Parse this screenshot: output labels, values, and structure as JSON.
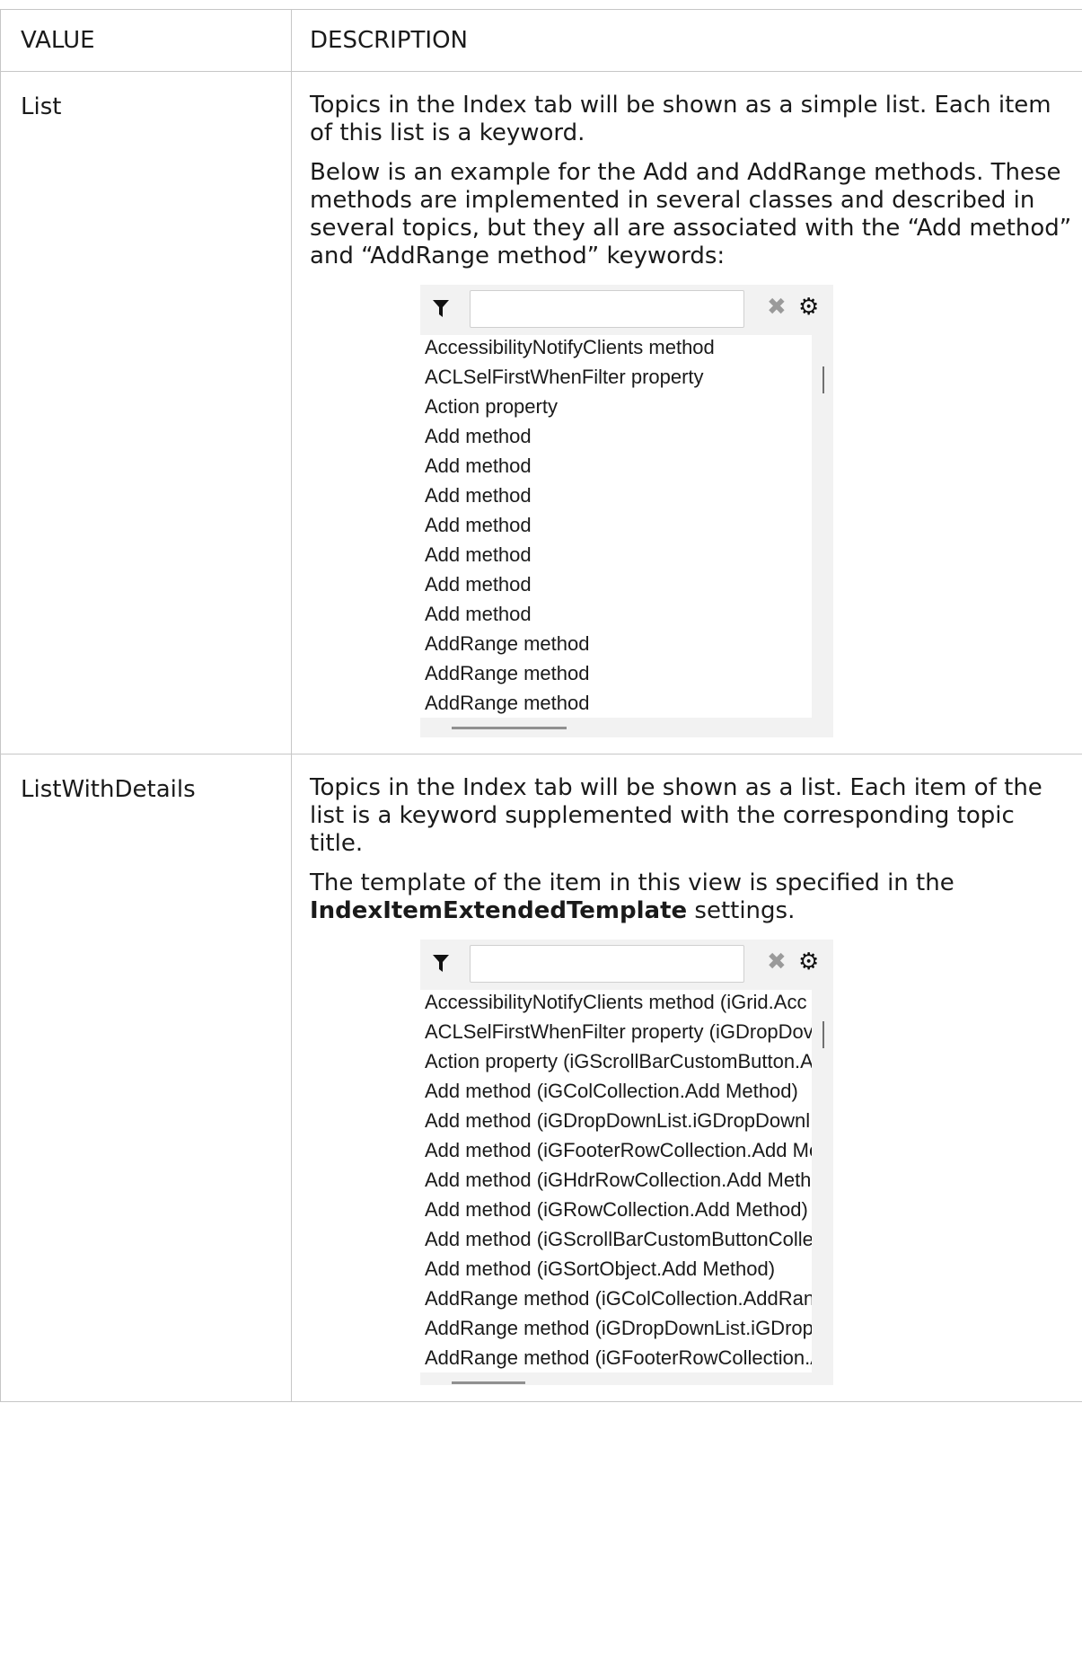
{
  "table": {
    "headers": {
      "value": "VALUE",
      "description": "DESCRIPTION"
    },
    "rows": [
      {
        "value": "List",
        "paragraphs": [
          "Topics in the Index tab will be shown as a simple list. Each item of this list is a keyword.",
          "Below is an example for the Add and AddRange methods. These methods are implemented in several classes and described in several topics, but they all are associated with the “Add method” and “AddRange method” keywords:"
        ],
        "widget": {
          "filter_value": "",
          "items": [
            "AccessibilityNotifyClients method",
            "ACLSelFirstWhenFilter property",
            "Action property",
            "Add method",
            "Add method",
            "Add method",
            "Add method",
            "Add method",
            "Add method",
            "Add method",
            "AddRange method",
            "AddRange method",
            "AddRange method"
          ]
        }
      },
      {
        "value": "ListWithDetails",
        "paragraphs": [
          "Topics in the Index tab will be shown as a list. Each item of the list is a keyword supplemented with the corresponding topic title."
        ],
        "template_para": {
          "before": "The template of the item in this view is specified in the ",
          "bold": "IndexItemExtendedTemplate",
          "after": " settings."
        },
        "widget": {
          "filter_value": "",
          "items": [
            "AccessibilityNotifyClients method (iGrid.Acc ",
            "ACLSelFirstWhenFilter property (iGDropDov",
            "Action property (iGScrollBarCustomButton.A",
            "Add method (iGColCollection.Add Method)",
            "Add method (iGDropDownList.iGDropDownl",
            "Add method (iGFooterRowCollection.Add Me",
            "Add method (iGHdrRowCollection.Add Meth",
            "Add method (iGRowCollection.Add Method)",
            "Add method (iGScrollBarCustomButtonColle",
            "Add method (iGSortObject.Add Method)",
            "AddRange method (iGColCollection.AddRanɡ",
            "AddRange method (iGDropDownList.iGDrop",
            "AddRange method (iGFooterRowCollection.A"
          ]
        }
      }
    ]
  },
  "icons": {
    "filter": "filter-funnel-icon",
    "clear": "clear-x-icon",
    "settings": "gear-icon"
  }
}
